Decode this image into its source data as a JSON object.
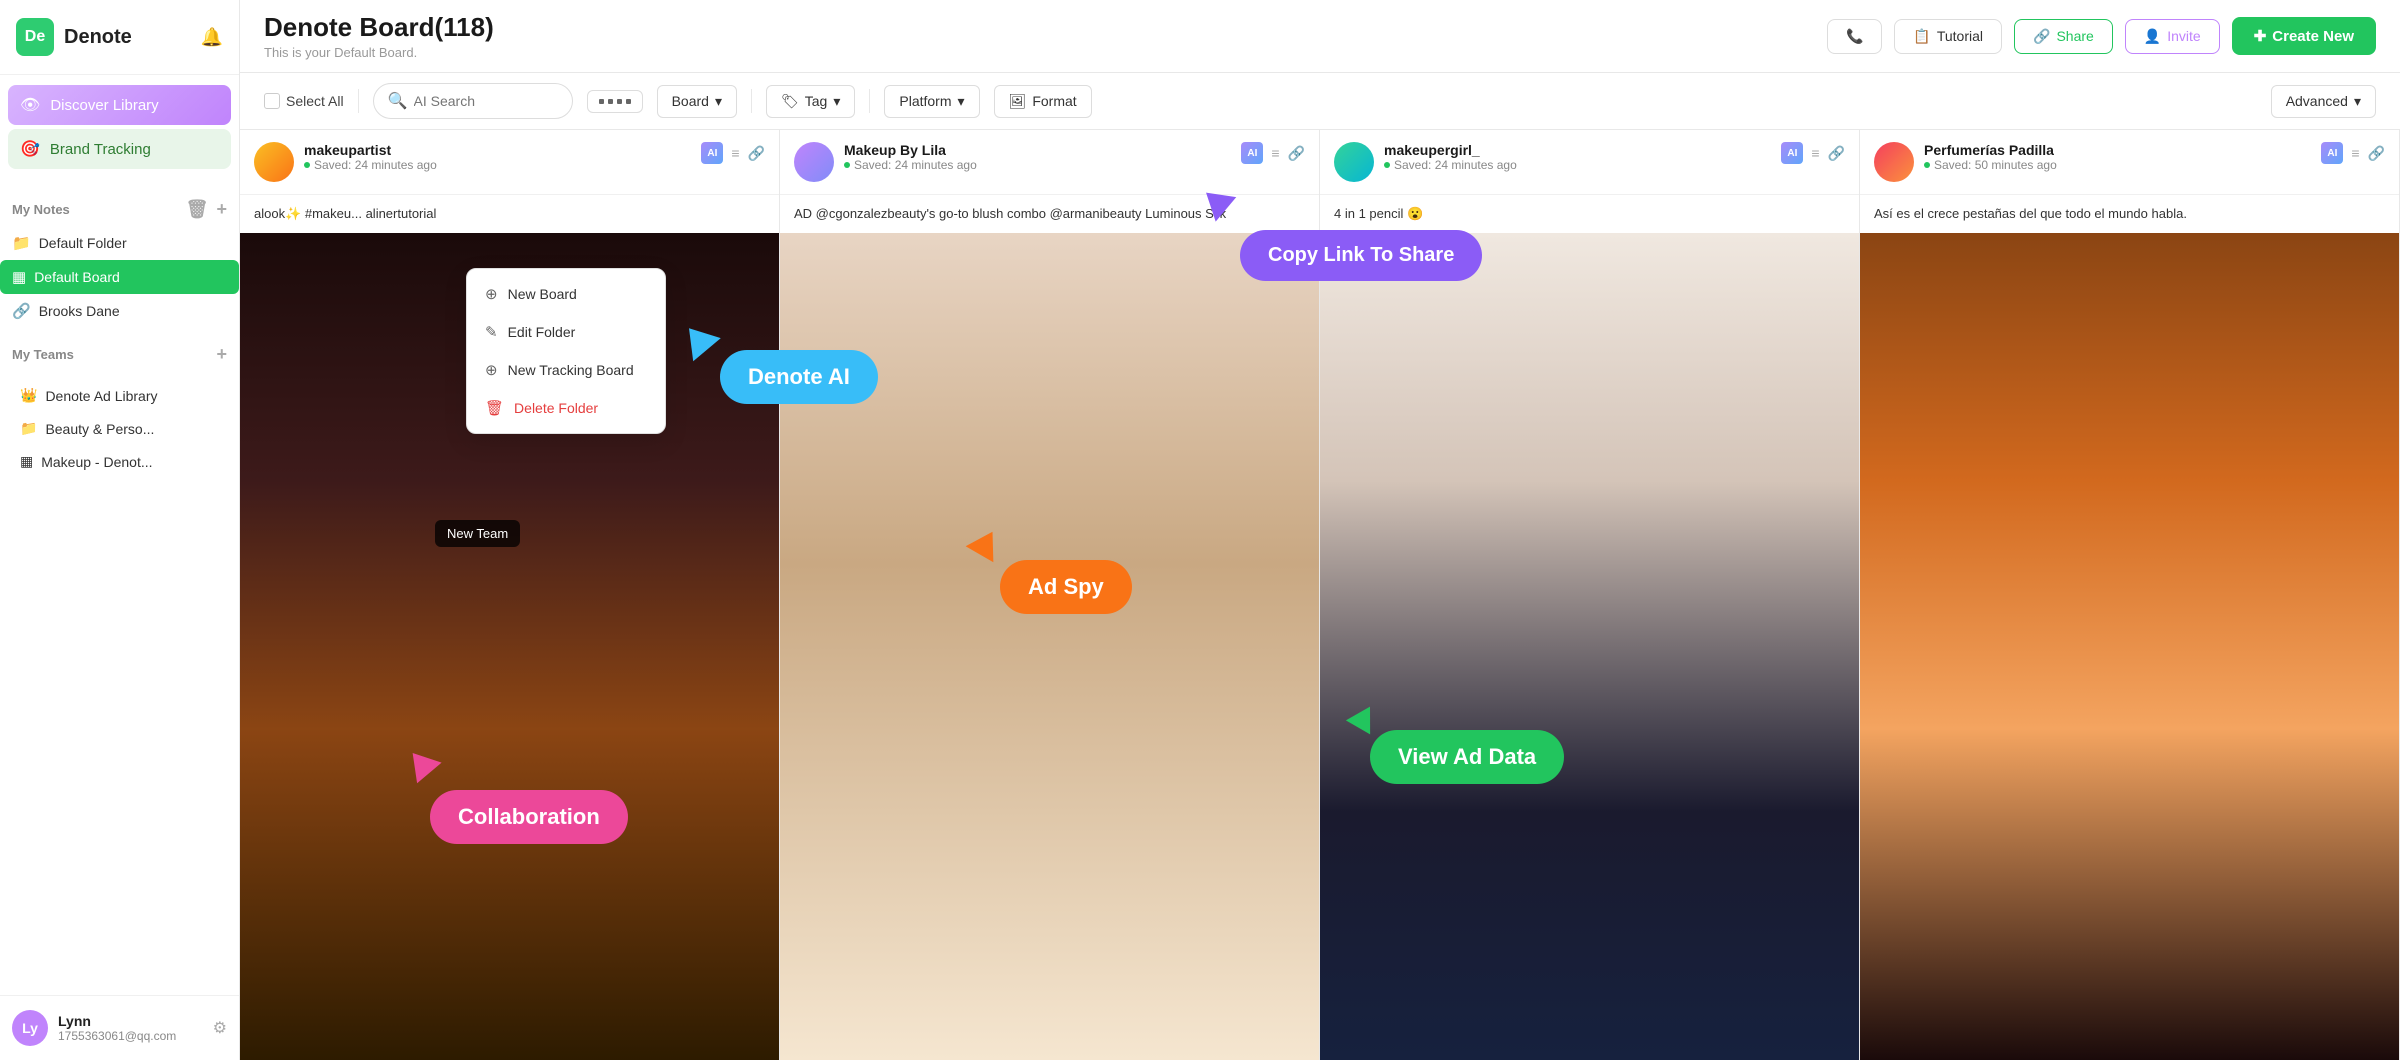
{
  "app": {
    "logo_letters": "De",
    "logo_name": "Denote"
  },
  "sidebar": {
    "discover_library": "Discover Library",
    "brand_tracking": "Brand Tracking",
    "my_notes_label": "My Notes",
    "default_folder": "Default Folder",
    "default_board": "Default Board",
    "brooks_dane": "Brooks Dane",
    "my_teams_label": "My Teams",
    "denote_ad_library": "Denote Ad Library",
    "beauty_person": "Beauty & Perso...",
    "makeup_denot": "Makeup - Denot...",
    "user_name": "Lynn",
    "user_email": "1755363061@qq.com",
    "user_initials": "Ly"
  },
  "top_bar": {
    "board_title": "Denote Board(118)",
    "board_subtitle": "This is your Default Board.",
    "tutorial_btn": "Tutorial",
    "share_btn": "Share",
    "invite_btn": "Invite",
    "create_btn": "Create New"
  },
  "toolbar": {
    "select_all": "Select All",
    "search_placeholder": "AI Search",
    "board_label": "Board",
    "tag_label": "Tag",
    "platform_label": "Platform",
    "format_label": "Format",
    "advanced_label": "Advanced"
  },
  "context_menu": {
    "new_board": "New Board",
    "edit_folder": "Edit Folder",
    "new_tracking_board": "New Tracking Board",
    "delete_folder": "Delete Folder"
  },
  "cards": [
    {
      "username": "makeupartist",
      "saved": "Saved: 24 minutes ago",
      "description": "alook✨ #makeu... alinertutorial",
      "img_class": "img-eye-1"
    },
    {
      "username": "Makeup By Lila",
      "saved": "Saved: 24 minutes ago",
      "description": "AD @cgonzalezbeauty's go-to blush combo @armanibeauty Luminous Silk",
      "img_class": "img-woman-1"
    },
    {
      "username": "makeupergirl_",
      "saved": "Saved: 24 minutes ago",
      "description": "4 in 1 pencil 😮",
      "img_class": "img-woman-2"
    },
    {
      "username": "Perfumerías Padilla",
      "saved": "Saved: 50 minutes ago",
      "description": "Así es el crece pestañas del que todo el mundo habla.",
      "img_class": "img-eye-2"
    }
  ],
  "callouts": {
    "denote_ai": "Denote AI",
    "ad_spy": "Ad Spy",
    "collaboration": "Collaboration",
    "view_ad_data": "View Ad Data",
    "copy_link": "Copy Link To Share"
  },
  "tooltips": {
    "new_team": "New Team"
  }
}
